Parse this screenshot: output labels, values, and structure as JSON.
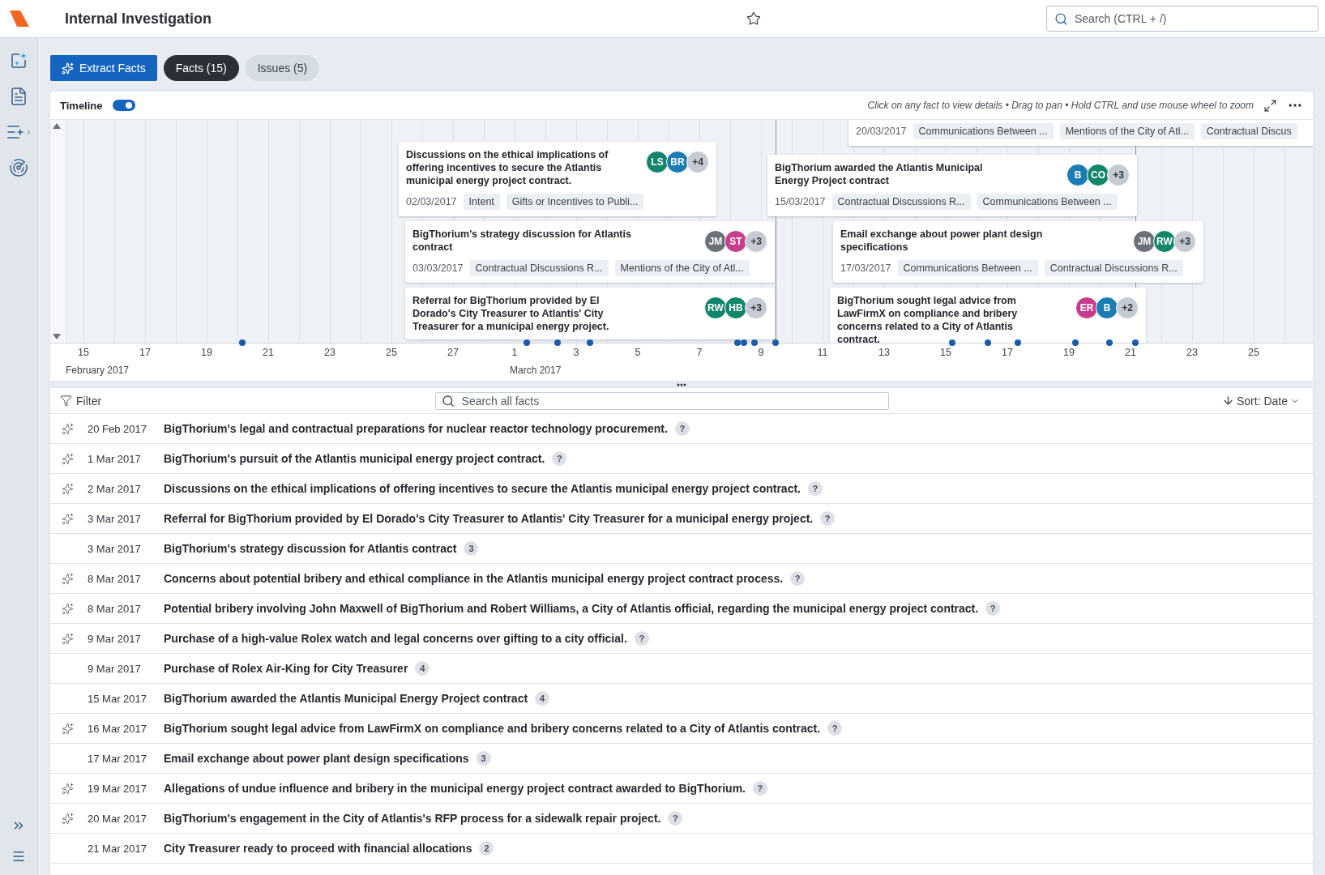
{
  "header": {
    "title": "Internal Investigation",
    "search_placeholder": "Search (CTRL + /)"
  },
  "toolbar": {
    "extract_label": "Extract Facts",
    "tabs": [
      {
        "label": "Facts (15)",
        "selected": true
      },
      {
        "label": "Issues (5)",
        "selected": false
      }
    ]
  },
  "timeline": {
    "label": "Timeline",
    "toggle_on": true,
    "hint": "Click on any fact to view details • Drag to pan • Hold CTRL and use mouse wheel to zoom",
    "cards": [
      {
        "date": "20/03/2017",
        "tags": [
          "Communications Between ...",
          "Mentions of the City of Atl...",
          "Contractual Discus"
        ]
      },
      {
        "title": "Discussions on the ethical implications of offering incentives to secure the Atlantis municipal energy project contract.",
        "date": "02/03/2017",
        "tags": [
          "Intent",
          "Gifts or Incentives to Publi..."
        ],
        "avatars": [
          {
            "initials": "LS",
            "color": "#12866a"
          },
          {
            "initials": "BR",
            "color": "#1b7db3"
          }
        ],
        "more": "+4"
      },
      {
        "title": "BigThorium awarded the Atlantis Municipal Energy Project contract",
        "date": "15/03/2017",
        "tags": [
          "Contractual Discussions R...",
          "Communications Between ..."
        ],
        "avatars": [
          {
            "initials": "B",
            "color": "#1b7db3"
          },
          {
            "initials": "CO",
            "color": "#12866a"
          }
        ],
        "more": "+3"
      },
      {
        "title": "BigThorium's strategy discussion for Atlantis contract",
        "date": "03/03/2017",
        "tags": [
          "Contractual Discussions R...",
          "Mentions of the City of Atl..."
        ],
        "avatars": [
          {
            "initials": "JM",
            "color": "#6b7178"
          },
          {
            "initials": "ST",
            "color": "#c63d8c"
          }
        ],
        "more": "+3"
      },
      {
        "title": "Email exchange about power plant design specifications",
        "date": "17/03/2017",
        "tags": [
          "Communications Between ...",
          "Contractual Discussions R..."
        ],
        "avatars": [
          {
            "initials": "JM",
            "color": "#6b7178"
          },
          {
            "initials": "RW",
            "color": "#12866a"
          }
        ],
        "more": "+3"
      },
      {
        "title": "Referral for BigThorium provided by El Dorado's City Treasurer to Atlantis' City Treasurer for a municipal energy project.",
        "avatars": [
          {
            "initials": "RW",
            "color": "#12866a"
          },
          {
            "initials": "HB",
            "color": "#12866a"
          }
        ],
        "more": "+3"
      },
      {
        "title": "BigThorium sought legal advice from LawFirmX on compliance and bribery concerns related to a City of Atlantis contract.",
        "avatars": [
          {
            "initials": "ER",
            "color": "#c63d8c"
          },
          {
            "initials": "B",
            "color": "#1b7db3"
          }
        ],
        "more": "+2"
      }
    ],
    "ticks": [
      "15",
      "17",
      "19",
      "21",
      "23",
      "25",
      "27",
      "1",
      "3",
      "5",
      "7",
      "9",
      "11",
      "13",
      "15",
      "17",
      "19",
      "21",
      "23",
      "25"
    ],
    "months": [
      "February 2017",
      "March 2017"
    ]
  },
  "list": {
    "filter_label": "Filter",
    "search_placeholder": "Search all facts",
    "sort_label": "Sort: Date",
    "facts": [
      {
        "ai": true,
        "date": "20 Feb 2017",
        "title": "BigThorium's legal and contractual preparations for nuclear reactor technology procurement.",
        "badge": "?"
      },
      {
        "ai": true,
        "date": "1 Mar 2017",
        "title": "BigThorium's pursuit of the Atlantis municipal energy project contract.",
        "badge": "?"
      },
      {
        "ai": true,
        "date": "2 Mar 2017",
        "title": "Discussions on the ethical implications of offering incentives to secure the Atlantis municipal energy project contract.",
        "badge": "?"
      },
      {
        "ai": true,
        "date": "3 Mar 2017",
        "title": "Referral for BigThorium provided by El Dorado's City Treasurer to Atlantis' City Treasurer for a municipal energy project.",
        "badge": "?"
      },
      {
        "ai": false,
        "date": "3 Mar 2017",
        "title": "BigThorium's strategy discussion for Atlantis contract",
        "badge": "3"
      },
      {
        "ai": true,
        "date": "8 Mar 2017",
        "title": "Concerns about potential bribery and ethical compliance in the Atlantis municipal energy project contract process.",
        "badge": "?"
      },
      {
        "ai": true,
        "date": "8 Mar 2017",
        "title": "Potential bribery involving John Maxwell of BigThorium and Robert Williams, a City of Atlantis official, regarding the municipal energy project contract.",
        "badge": "?"
      },
      {
        "ai": true,
        "date": "9 Mar 2017",
        "title": "Purchase of a high-value Rolex watch and legal concerns over gifting to a city official.",
        "badge": "?"
      },
      {
        "ai": false,
        "date": "9 Mar 2017",
        "title": "Purchase of Rolex Air-King for City Treasurer",
        "badge": "4"
      },
      {
        "ai": false,
        "date": "15 Mar 2017",
        "title": "BigThorium awarded the Atlantis Municipal Energy Project contract",
        "badge": "4"
      },
      {
        "ai": true,
        "date": "16 Mar 2017",
        "title": "BigThorium sought legal advice from LawFirmX on compliance and bribery concerns related to a City of Atlantis contract.",
        "badge": "?"
      },
      {
        "ai": false,
        "date": "17 Mar 2017",
        "title": "Email exchange about power plant design specifications",
        "badge": "3"
      },
      {
        "ai": true,
        "date": "19 Mar 2017",
        "title": "Allegations of undue influence and bribery in the municipal energy project contract awarded to BigThorium.",
        "badge": "?"
      },
      {
        "ai": true,
        "date": "20 Mar 2017",
        "title": "BigThorium's engagement in the City of Atlantis's RFP process for a sidewalk repair project.",
        "badge": "?"
      },
      {
        "ai": false,
        "date": "21 Mar 2017",
        "title": "City Treasurer ready to proceed with financial allocations",
        "badge": "2"
      }
    ]
  }
}
